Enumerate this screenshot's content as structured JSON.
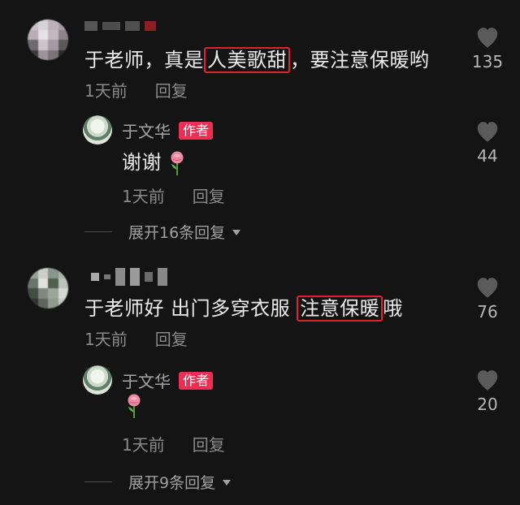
{
  "comments": [
    {
      "text_before": "于老师，真是",
      "text_highlight": "人美歌甜",
      "text_after": "，要注意保暖哟",
      "time": "1天前",
      "reply_label": "回复",
      "likes": "135",
      "reply": {
        "author": "于文华",
        "badge": "作者",
        "text": "谢谢",
        "emoji": "rose",
        "time": "1天前",
        "reply_label": "回复",
        "likes": "44"
      },
      "expand_label": "展开16条回复"
    },
    {
      "text_before": "于老师好 出门多穿衣服 ",
      "text_highlight": "注意保暖",
      "text_after": "哦",
      "time": "1天前",
      "reply_label": "回复",
      "likes": "76",
      "reply": {
        "author": "于文华",
        "badge": "作者",
        "text": "",
        "emoji": "rose",
        "time": "1天前",
        "reply_label": "回复",
        "likes": "20"
      },
      "expand_label": "展开9条回复"
    }
  ],
  "colors": {
    "background": "#141414",
    "highlight_border": "#e0222a",
    "badge": "#ee2d55"
  },
  "icons": [
    "heart-icon",
    "rose-emoji",
    "caret-down-icon"
  ]
}
